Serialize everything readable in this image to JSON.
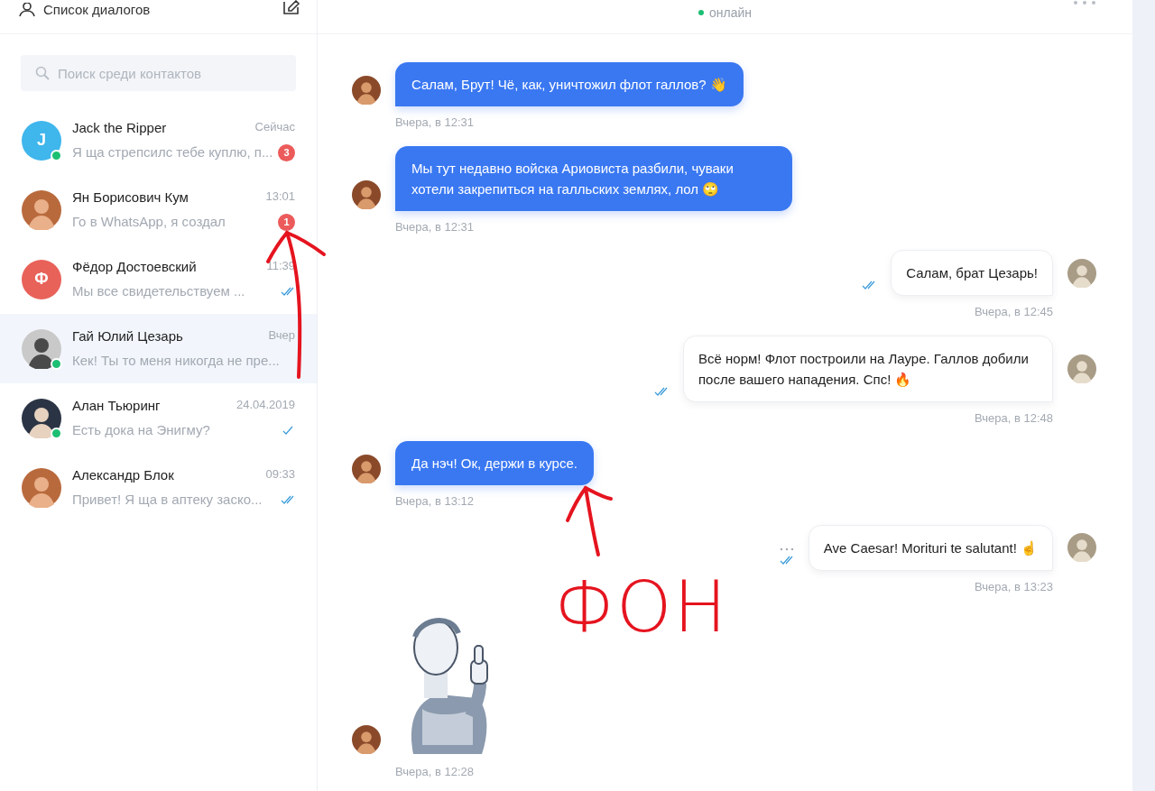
{
  "sidebar": {
    "title": "Список диалогов",
    "search": {
      "placeholder": "Поиск среди контактов"
    },
    "dialogs": [
      {
        "name": "Jack the Ripper",
        "preview": "Я ща стрепсилс тебе куплю, п...",
        "time": "Сейчас",
        "avatar": {
          "kind": "letter",
          "letter": "J",
          "color": "#3fb6ec"
        },
        "online": true,
        "unread": "3",
        "selected": false
      },
      {
        "name": "Ян Борисович Кум",
        "preview": "Го в WhatsApp, я создал",
        "time": "13:01",
        "avatar": {
          "kind": "photo"
        },
        "online": false,
        "unread": "1",
        "selected": false
      },
      {
        "name": "Фёдор Достоевский",
        "preview": "Мы все свидетельствуем ...",
        "time": "11:39",
        "avatar": {
          "kind": "letter",
          "letter": "Ф",
          "color": "#e8625a"
        },
        "online": false,
        "read": true,
        "selected": false
      },
      {
        "name": "Гай Юлий Цезарь",
        "preview": "Кек! Ты то меня никогда не пре...",
        "time": "Вчер",
        "avatar": {
          "kind": "photo"
        },
        "online": true,
        "selected": true
      },
      {
        "name": "Алан Тьюринг",
        "preview": "Есть дока на Энигму?",
        "time": "24.04.2019",
        "avatar": {
          "kind": "photo"
        },
        "online": true,
        "read": false,
        "selected": false
      },
      {
        "name": "Александр Блок",
        "preview": "Привет! Я ща в аптеку заско...",
        "time": "09:33",
        "avatar": {
          "kind": "photo"
        },
        "online": false,
        "read": true,
        "selected": false
      }
    ]
  },
  "chat": {
    "presence": "онлайн",
    "messages": [
      {
        "kind": "incoming",
        "text": "Салам, Брут! Чё, как, уничтожил флот галлов? 👋",
        "time": "Вчера, в 12:31"
      },
      {
        "kind": "incoming",
        "text": "Мы тут недавно войска Ариовиста разбили, чуваки хотели закрепиться на галльских землях, лол 🙄",
        "time": "Вчера, в 12:31"
      },
      {
        "kind": "outgoing",
        "text": "Салам, брат Цезарь!",
        "time": "Вчера, в 12:45",
        "read": true
      },
      {
        "kind": "outgoing",
        "text": "Всё норм! Флот построили на Лауре. Галлов добили после вашего нападения. Спс! 🔥",
        "time": "Вчера, в 12:48",
        "read": true
      },
      {
        "kind": "incoming",
        "text": "Да нэч! Ок, держи в курсе.",
        "time": "Вчера, в 13:12"
      },
      {
        "kind": "outgoing",
        "text": "Ave Caesar! Morituri te salutant! ☝️",
        "time": "Вчера, в 13:23",
        "read": true,
        "more": true
      },
      {
        "kind": "sticker",
        "time": "Вчера, в 12:28"
      }
    ]
  },
  "annotation": {
    "text": "ФОН"
  }
}
